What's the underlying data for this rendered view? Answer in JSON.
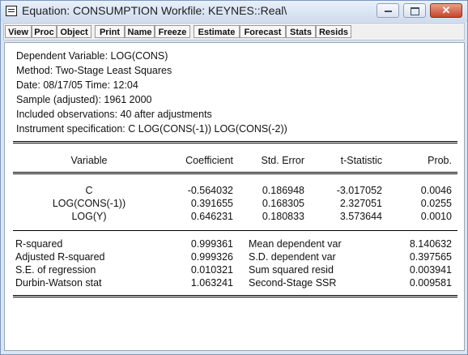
{
  "window": {
    "title": "Equation: CONSUMPTION   Workfile: KEYNES::Real\\"
  },
  "toolbar": {
    "buttons": [
      "View",
      "Proc",
      "Object",
      "Print",
      "Name",
      "Freeze",
      "Estimate",
      "Forecast",
      "Stats",
      "Resids"
    ]
  },
  "header_lines": [
    "Dependent Variable: LOG(CONS)",
    "Method: Two-Stage Least Squares",
    "Date: 08/17/05   Time: 12:04",
    "Sample (adjusted): 1961 2000",
    "Included observations: 40 after adjustments",
    "Instrument specification: C LOG(CONS(-1)) LOG(CONS(-2))"
  ],
  "coef_table": {
    "columns": [
      "Variable",
      "Coefficient",
      "Std. Error",
      "t-Statistic",
      "Prob."
    ],
    "rows": [
      [
        "C",
        "-0.564032",
        "0.186948",
        "-3.017052",
        "0.0046"
      ],
      [
        "LOG(CONS(-1))",
        "0.391655",
        "0.168305",
        "2.327051",
        "0.0255"
      ],
      [
        "LOG(Y)",
        "0.646231",
        "0.180833",
        "3.573644",
        "0.0010"
      ]
    ]
  },
  "stats_table": {
    "rows": [
      [
        "R-squared",
        "0.999361",
        "Mean dependent var",
        "8.140632"
      ],
      [
        "Adjusted R-squared",
        "0.999326",
        "S.D. dependent var",
        "0.397565"
      ],
      [
        "S.E. of regression",
        "0.010321",
        "Sum squared resid",
        "0.003941"
      ],
      [
        "Durbin-Watson stat",
        "1.063241",
        "Second-Stage SSR",
        "0.009581"
      ]
    ]
  },
  "colors": {
    "window_frame": "#dbe6f4",
    "close_button": "#c6452c",
    "content_bg": "#ffffff"
  },
  "icons": [
    "window-menu-icon",
    "minimize-icon",
    "maximize-icon",
    "close-icon"
  ]
}
